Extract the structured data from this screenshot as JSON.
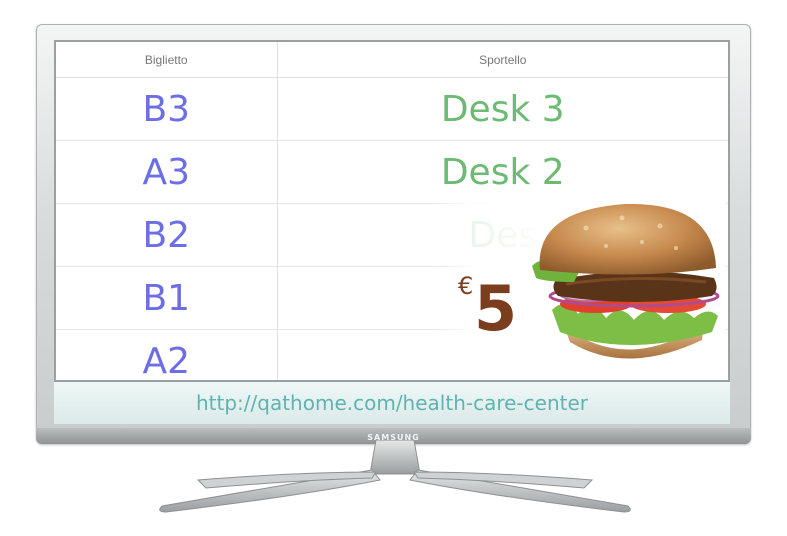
{
  "screen": {
    "headers": {
      "ticket": "Biglietto",
      "desk": "Sportello"
    },
    "rows": [
      {
        "ticket": "B3",
        "desk": "Desk 3"
      },
      {
        "ticket": "A3",
        "desk": "Desk 2"
      },
      {
        "ticket": "B2",
        "desk": "Des"
      },
      {
        "ticket": "B1",
        "desk": ""
      },
      {
        "ticket": "A2",
        "desk": ""
      }
    ]
  },
  "ad": {
    "currency": "€",
    "price": "5",
    "image": "burger-icon"
  },
  "url": "http://qathome.com/health-care-center",
  "tv": {
    "brand": "SAMSUNG"
  },
  "colors": {
    "ticket": "#6d6ee6",
    "desk": "#6dbb73",
    "url": "#5fb3b1",
    "price": "#7a3d1e"
  }
}
